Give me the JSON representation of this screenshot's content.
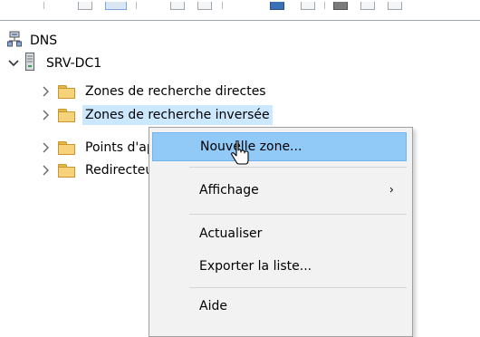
{
  "tree": {
    "root": {
      "label": "DNS",
      "icon": "dns-server-icon"
    },
    "server": {
      "label": "SRV-DC1",
      "icon": "server-icon",
      "expanded": true
    },
    "children": [
      {
        "label": "Zones de recherche directes",
        "icon": "folder-icon"
      },
      {
        "label": "Zones de recherche inversée",
        "icon": "folder-icon",
        "selected": true
      },
      {
        "label": "Points d'approbation",
        "icon": "folder-icon"
      },
      {
        "label": "Redirecteurs conditionnels",
        "icon": "folder-icon"
      }
    ]
  },
  "context_menu": {
    "items": [
      {
        "label": "Nouvelle zone...",
        "highlighted": true
      },
      {
        "label": "Affichage",
        "submenu": true,
        "submenu_arrow": "›"
      },
      {
        "label": "Actualiser"
      },
      {
        "label": "Exporter la liste..."
      },
      {
        "label": "Aide"
      }
    ]
  },
  "colors": {
    "selection": "#cce8ff",
    "menu_hover": "#91c9f7",
    "menu_background": "#f2f2f2",
    "folder": "#f6d37b"
  }
}
